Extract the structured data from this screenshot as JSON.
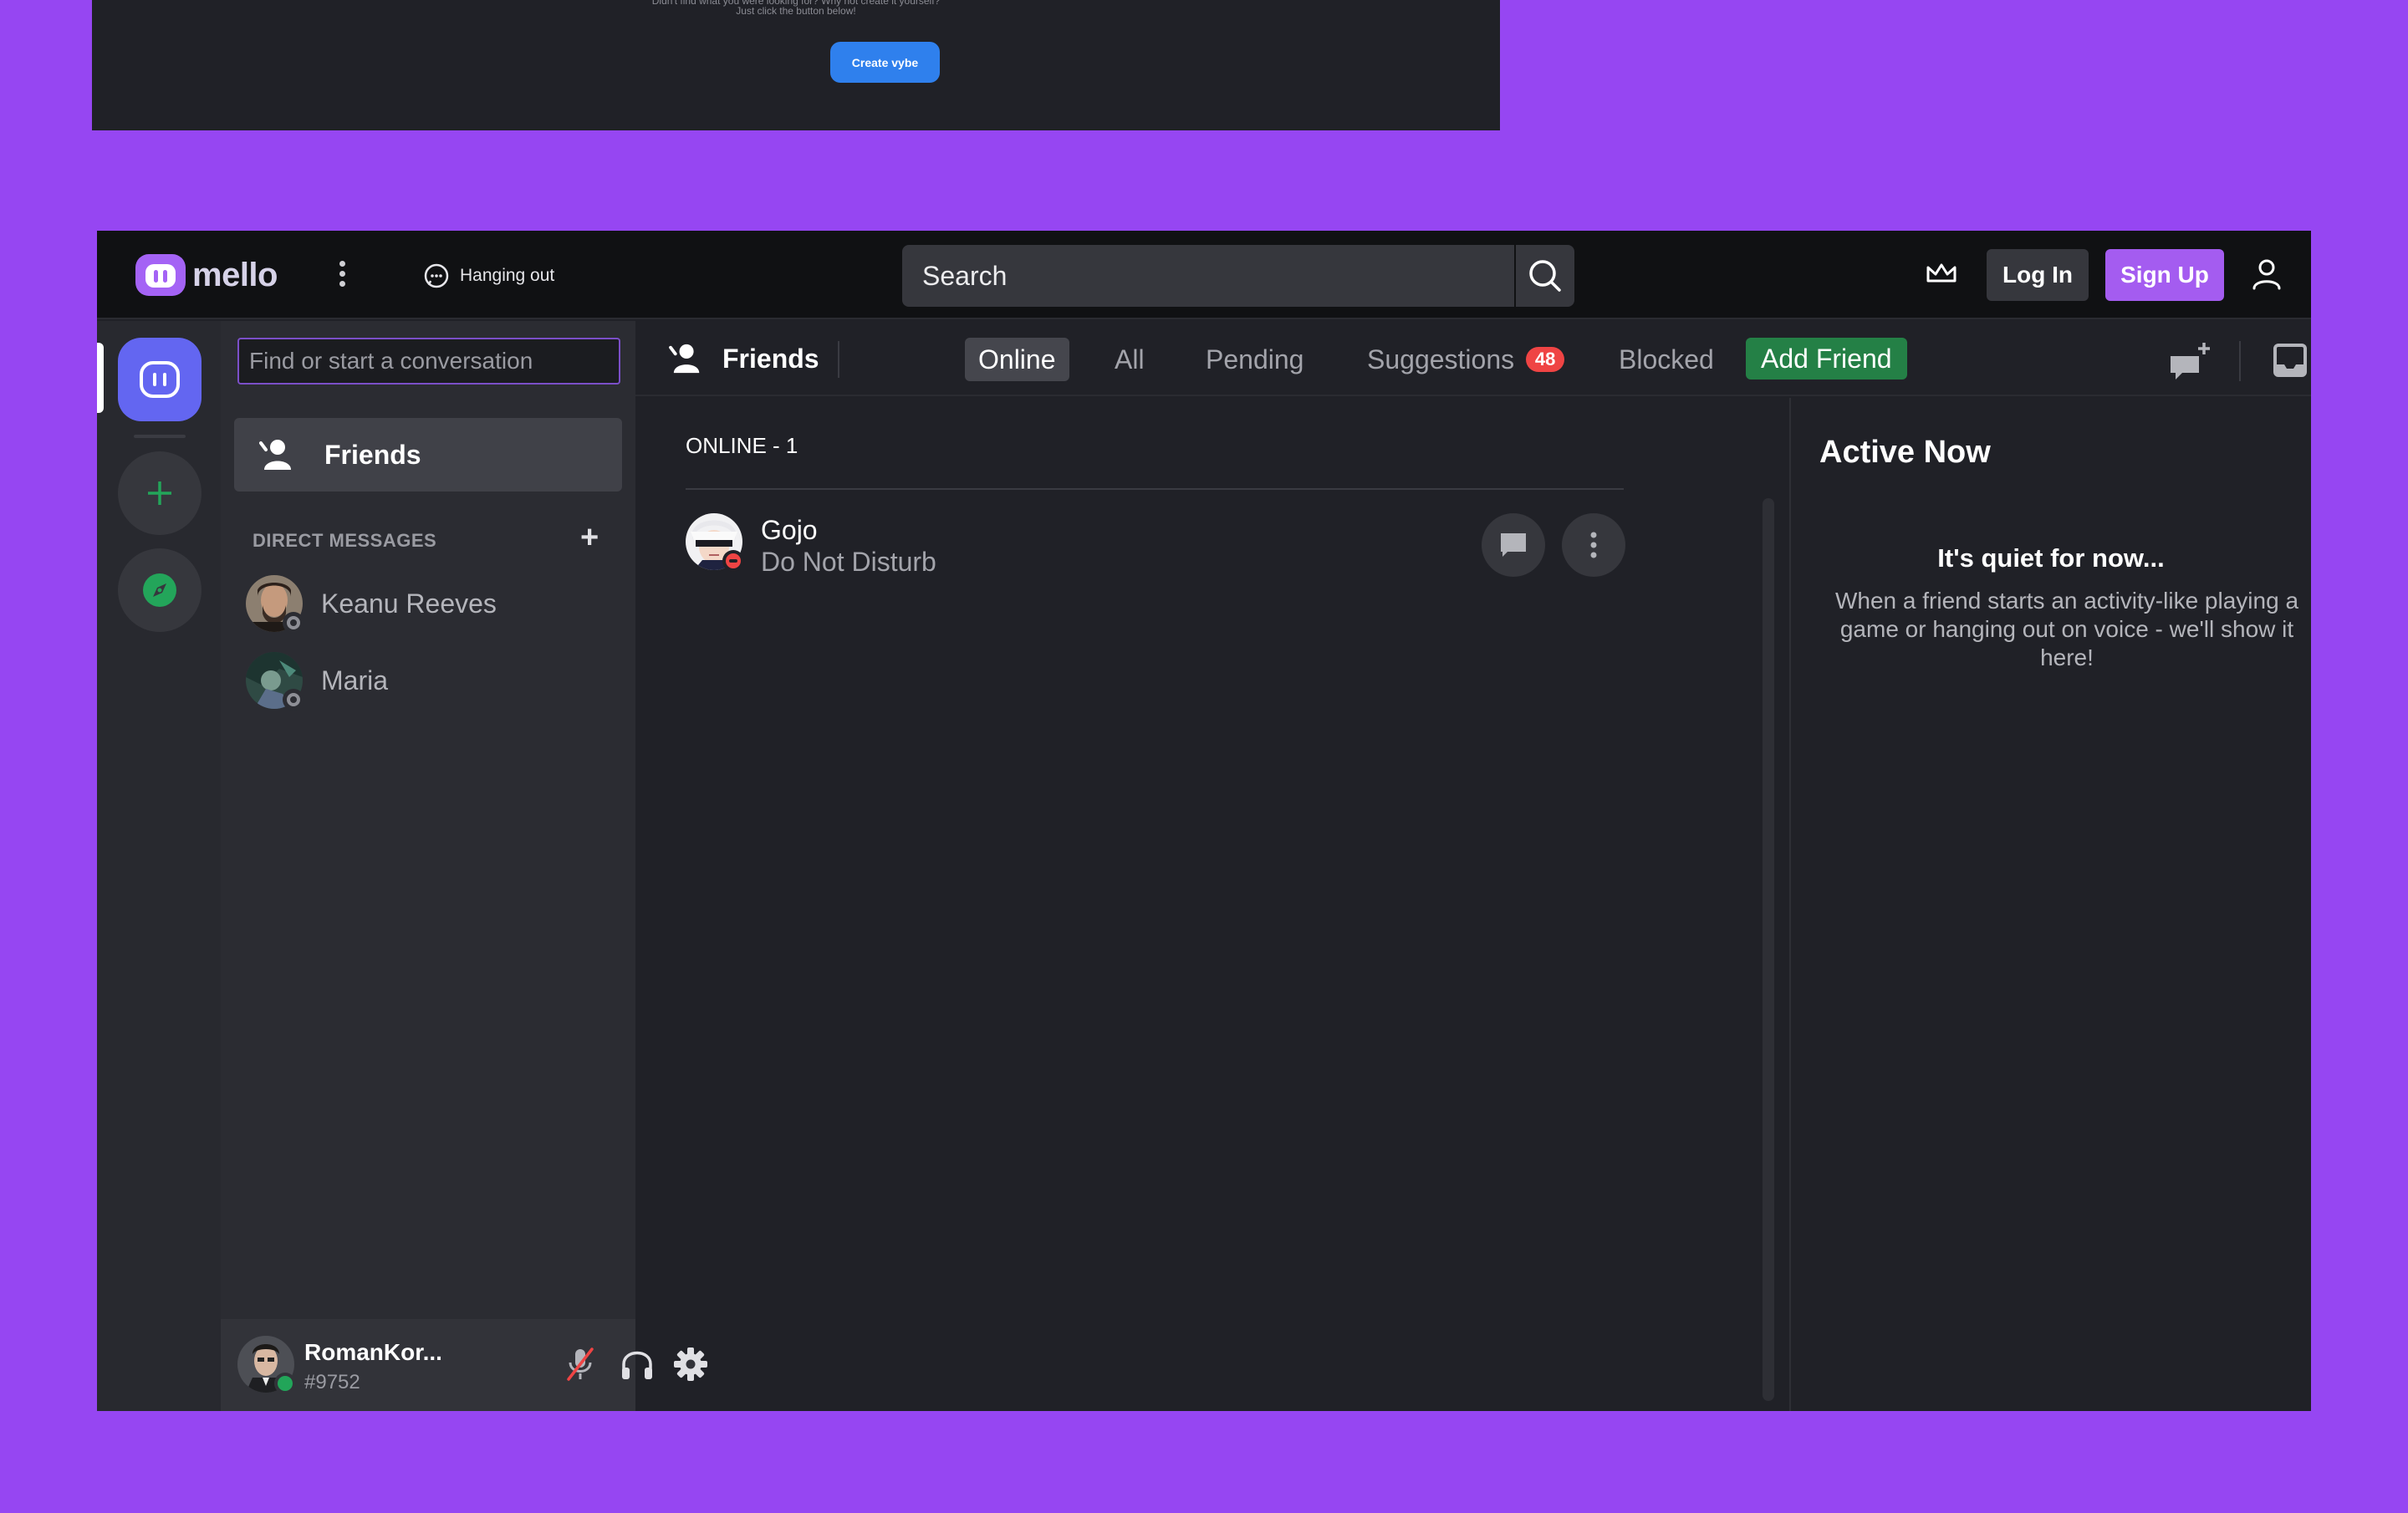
{
  "preview": {
    "hint_line1": "Didn't find what you were looking for? Why not create it yourself?",
    "hint_line2": "Just click the button below!",
    "create_button": "Create vybe"
  },
  "header": {
    "brand": "mello",
    "status": "Hanging out",
    "search_placeholder": "Search",
    "login": "Log In",
    "signup": "Sign Up"
  },
  "sidebar": {
    "find_placeholder": "Find or start a conversation",
    "friends_label": "Friends",
    "dm_header": "DIRECT MESSAGES",
    "dm_add": "+",
    "dms": [
      {
        "name": "Keanu Reeves"
      },
      {
        "name": "Maria"
      }
    ],
    "user": {
      "name": "RomanKor...",
      "tag": "#9752"
    }
  },
  "toolbar": {
    "title": "Friends",
    "tabs": [
      {
        "label": "Online"
      },
      {
        "label": "All"
      },
      {
        "label": "Pending"
      },
      {
        "label": "Suggestions",
        "badge": "48"
      },
      {
        "label": "Blocked"
      }
    ],
    "add_friend": "Add Friend"
  },
  "online": {
    "header": "ONLINE - 1",
    "friends": [
      {
        "name": "Gojo",
        "status": "Do Not Disturb"
      }
    ]
  },
  "active_now": {
    "title": "Active Now",
    "quiet": "It's quiet for now...",
    "description": "When a friend starts an activity-like playing a game or hanging out on voice - we'll show it here!"
  },
  "colors": {
    "background": "#9646f2",
    "accent": "#a45cf0",
    "home": "#6366f1",
    "add_friend": "#248046",
    "badge": "#ef4444",
    "online_green": "#22a559"
  }
}
